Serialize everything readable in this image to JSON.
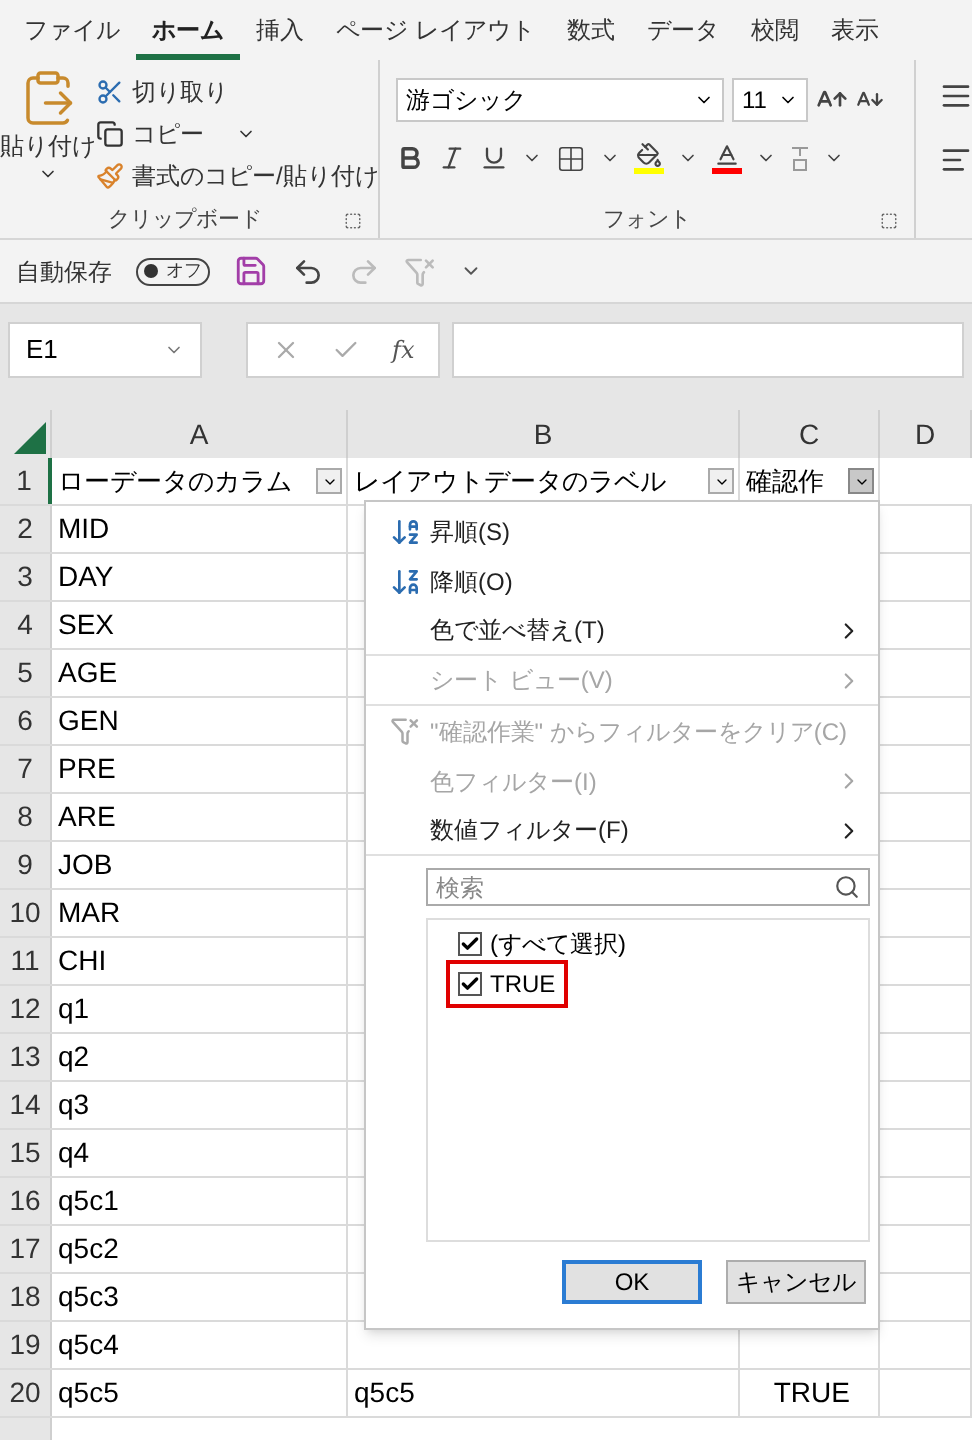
{
  "tabs": [
    {
      "label": "ファイル",
      "selected": false
    },
    {
      "label": "ホーム",
      "selected": true
    },
    {
      "label": "挿入",
      "selected": false
    },
    {
      "label": "ページ レイアウト",
      "selected": false
    },
    {
      "label": "数式",
      "selected": false
    },
    {
      "label": "データ",
      "selected": false
    },
    {
      "label": "校閲",
      "selected": false
    },
    {
      "label": "表示",
      "selected": false
    }
  ],
  "clipboard": {
    "paste": "貼り付け",
    "cut": "切り取り",
    "copy": "コピー",
    "format_painter": "書式のコピー/貼り付け",
    "group_label": "クリップボード"
  },
  "font": {
    "name": "游ゴシック",
    "size": "11",
    "group_label": "フォント"
  },
  "quick_access": {
    "autosave_label": "自動保存",
    "autosave_on": false,
    "autosave_state": "オフ"
  },
  "formula_bar": {
    "name_box": "E1",
    "function_label": "fx"
  },
  "columns": [
    "A",
    "B",
    "C",
    "D"
  ],
  "header_row": {
    "number": "1",
    "cells": [
      {
        "text": "ローデータのカラム",
        "filter_open": false
      },
      {
        "text": "レイアウトデータのラベル",
        "filter_open": false
      },
      {
        "text": "確認作",
        "filter_open": true
      }
    ]
  },
  "rows": [
    {
      "number": "2",
      "cells": [
        "MID"
      ]
    },
    {
      "number": "3",
      "cells": [
        "DAY"
      ]
    },
    {
      "number": "4",
      "cells": [
        "SEX"
      ]
    },
    {
      "number": "5",
      "cells": [
        "AGE"
      ]
    },
    {
      "number": "6",
      "cells": [
        "GEN"
      ]
    },
    {
      "number": "7",
      "cells": [
        "PRE"
      ]
    },
    {
      "number": "8",
      "cells": [
        "ARE"
      ]
    },
    {
      "number": "9",
      "cells": [
        "JOB"
      ]
    },
    {
      "number": "10",
      "cells": [
        "MAR"
      ]
    },
    {
      "number": "11",
      "cells": [
        "CHI"
      ]
    },
    {
      "number": "12",
      "cells": [
        "q1"
      ]
    },
    {
      "number": "13",
      "cells": [
        "q2"
      ]
    },
    {
      "number": "14",
      "cells": [
        "q3"
      ]
    },
    {
      "number": "15",
      "cells": [
        "q4"
      ]
    },
    {
      "number": "16",
      "cells": [
        "q5c1"
      ]
    },
    {
      "number": "17",
      "cells": [
        "q5c2"
      ]
    },
    {
      "number": "18",
      "cells": [
        "q5c3"
      ]
    },
    {
      "number": "19",
      "cells": [
        "q5c4"
      ]
    },
    {
      "number": "20",
      "cells": [
        "q5c5",
        "q5c5",
        "TRUE"
      ]
    }
  ],
  "filter_menu": {
    "items": [
      {
        "kind": "sort_asc",
        "label": "昇順(S)",
        "disabled": false,
        "submenu": false,
        "separator_after": false
      },
      {
        "kind": "sort_desc",
        "label": "降順(O)",
        "disabled": false,
        "submenu": false,
        "separator_after": false
      },
      {
        "kind": "plain",
        "label": "色で並べ替え(T)",
        "disabled": false,
        "submenu": true,
        "separator_after": true
      },
      {
        "kind": "plain",
        "label": "シート ビュー(V)",
        "disabled": true,
        "submenu": true,
        "separator_after": true
      },
      {
        "kind": "clear_filter",
        "label": "\"確認作業\" からフィルターをクリア(C)",
        "disabled": true,
        "submenu": false,
        "separator_after": false
      },
      {
        "kind": "plain",
        "label": "色フィルター(I)",
        "disabled": true,
        "submenu": true,
        "separator_after": false
      },
      {
        "kind": "plain",
        "label": "数値フィルター(F)",
        "disabled": false,
        "submenu": true,
        "separator_after": true
      }
    ],
    "search": {
      "placeholder": "検索"
    },
    "values": [
      {
        "label": "(すべて選択)",
        "checked": true,
        "marked": false
      },
      {
        "label": "TRUE",
        "checked": true,
        "marked": true
      }
    ],
    "buttons": [
      {
        "label": "OK",
        "selected": true
      },
      {
        "label": "キャンセル",
        "selected": false
      }
    ]
  }
}
